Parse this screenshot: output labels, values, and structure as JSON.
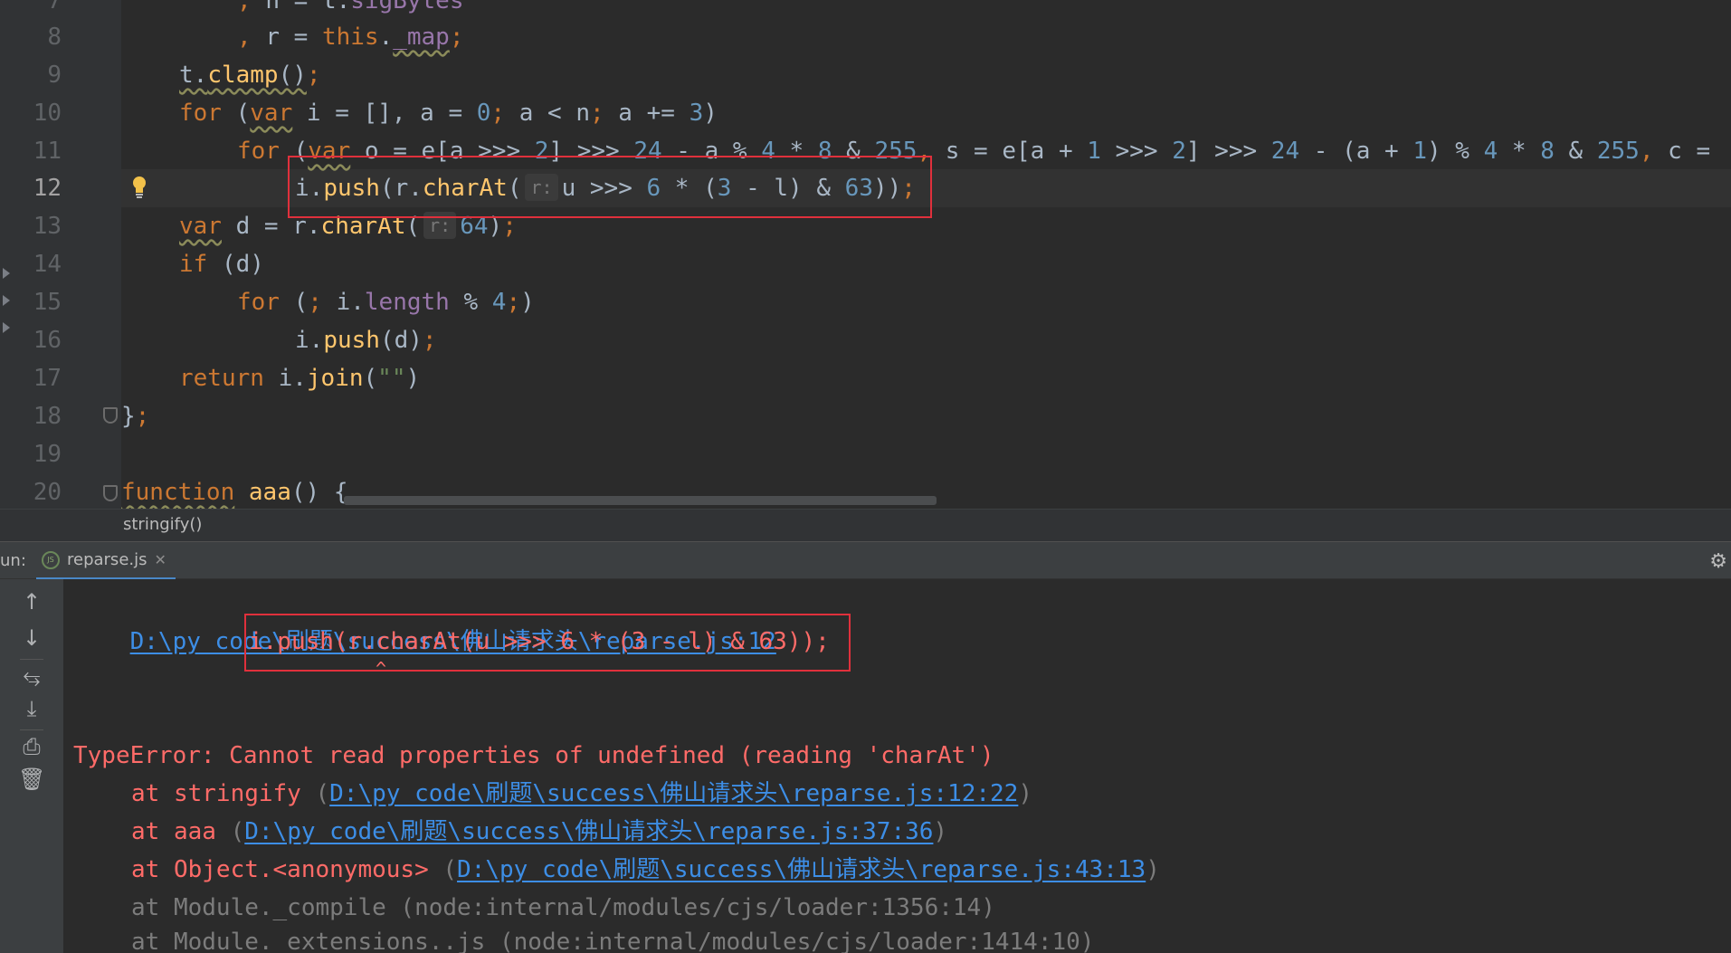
{
  "editor": {
    "line_numbers": [
      "7",
      "8",
      "9",
      "10",
      "11",
      "12",
      "13",
      "14",
      "15",
      "16",
      "17",
      "18",
      "19",
      "20"
    ],
    "current_line": "12",
    "line7": {
      "comma": ",",
      "n": "n",
      "eq": "=",
      "obj": "t.",
      "prop": "sigBytes"
    },
    "line8": {
      "comma": ",",
      "r": "r",
      "eq": "=",
      "this": "this",
      "dot": ".",
      "prop": "_map",
      "semi": ";"
    },
    "line9": {
      "obj": "t.",
      "fn": "clamp",
      "rest": "()",
      "semi": ";"
    },
    "line10": {
      "for": "for",
      "open": "(",
      "var": "var",
      "t1": "i = [], a = ",
      "n0": "0",
      "semi1": ";",
      "t2": " a < n",
      "semi2": ";",
      "t3": " a += ",
      "n3": "3",
      "close": ")"
    },
    "line11": {
      "for": "for",
      "open": "(",
      "var": "var",
      "t1": "o = e[a >>> ",
      "n2": "2",
      "t2": "] >>> ",
      "n24": "24",
      "t3": " - a % ",
      "n4": "4",
      "t4": " * ",
      "n8": "8",
      "t5": " & ",
      "n255": "255",
      "comma": ",",
      "t6": " s = e[a + ",
      "n1": "1",
      "t7": " >>> ",
      "n2b": "2",
      "t8": "] >>> ",
      "n24b": "24",
      "t9": " - (a + ",
      "n1b": "1",
      "t10": ") % ",
      "n4b": "4",
      "t11": " * ",
      "n8b": "8",
      "t12": " & ",
      "n255b": "255",
      "comma2": ",",
      "t13": " c ="
    },
    "line12": {
      "obj": "i.",
      "fn1": "push",
      "t1": "(r.",
      "fn2": "charAt",
      "t2": "(",
      "hint": "r:",
      "t3": "u >>> ",
      "n6": "6",
      "t4": " * (",
      "n3": "3",
      "t5": " - l) & ",
      "n63": "63",
      "t6": "))",
      "semi": ";"
    },
    "line13": {
      "var": "var",
      "t1": " d = r.",
      "fn": "charAt",
      "t2": "(",
      "hint": "r:",
      "n64": "64",
      "t3": ")",
      "semi": ";"
    },
    "line14": {
      "if": "if",
      "t1": " (d)"
    },
    "line15": {
      "for": "for",
      "t1": " (",
      "semi1": ";",
      "t2": " i.",
      "prop": "length",
      "t3": " % ",
      "n4": "4",
      "semi2": ";",
      "t4": ")"
    },
    "line16": {
      "obj": "i.",
      "fn": "push",
      "t1": "(d)",
      "semi": ";"
    },
    "line17": {
      "ret": "return",
      "t1": " i.",
      "fn": "join",
      "t2": "(",
      "str": "\"\"",
      "t3": ")"
    },
    "line18": {
      "t1": "}",
      "semi": ";"
    },
    "line20": {
      "kw": "function",
      "fn": "aaa",
      "t1": "() {"
    }
  },
  "breadcrumb": "stringify()",
  "run_panel": {
    "label": "un:",
    "tab_label": "reparse.js",
    "tab_icon_text": "JS"
  },
  "console": {
    "location_link": "D:\\py_code\\刷题\\success\\佛山请求头\\reparse.js:12",
    "source_line": "i.push(r.charAt(u >>> 6 * (3 - l) & 63));",
    "caret": "^",
    "error_message": "TypeError: Cannot read properties of undefined (reading 'charAt')",
    "stack": [
      {
        "prefix": "at stringify ",
        "link": "D:\\py_code\\刷题\\success\\佛山请求头\\reparse.js:12:22"
      },
      {
        "prefix": "at aaa ",
        "link": "D:\\py_code\\刷题\\success\\佛山请求头\\reparse.js:37:36"
      },
      {
        "prefix": "at Object.<anonymous> ",
        "link": "D:\\py_code\\刷题\\success\\佛山请求头\\reparse.js:43:13"
      },
      {
        "text": "at Module._compile (node:internal/modules/cjs/loader:1356:14)"
      },
      {
        "text": "at Module._extensions..js (node:internal/modules/cjs/loader:1414:10)"
      }
    ]
  },
  "colors": {
    "keyword": "#cc7832",
    "number": "#6897bb",
    "function": "#ffc66d",
    "error": "#ff6b68",
    "link": "#3d8ee6",
    "highlight_box": "#e0303c"
  },
  "icons": [
    "js-file-icon",
    "close-icon",
    "gear-icon",
    "arrow-up-icon",
    "arrow-down-icon",
    "soft-wrap-icon",
    "scroll-to-end-icon",
    "print-icon",
    "trash-icon",
    "lightbulb-icon"
  ]
}
